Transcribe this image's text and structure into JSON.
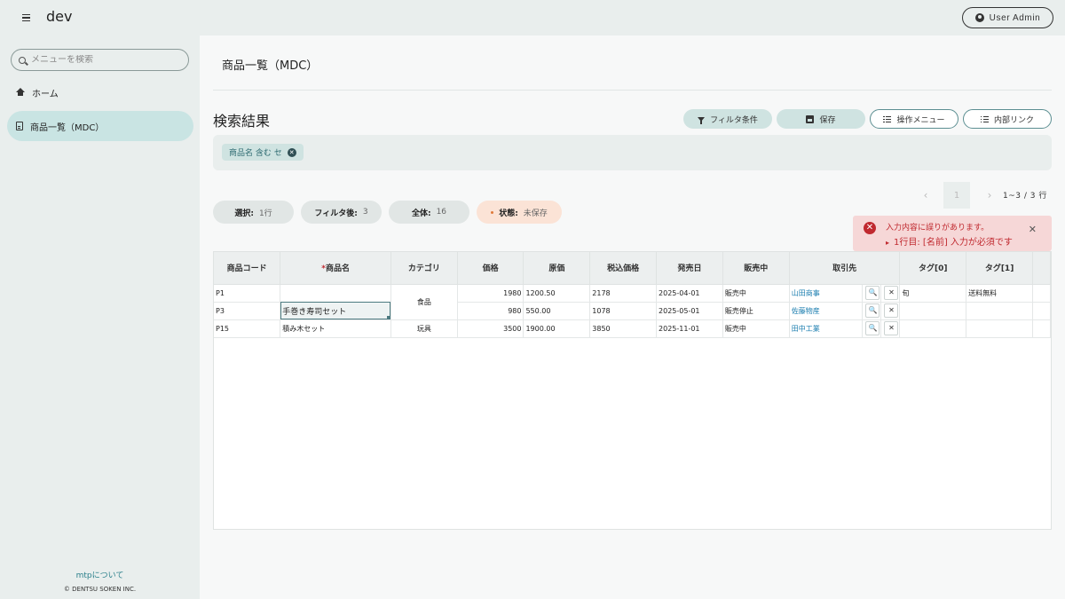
{
  "header": {
    "app_title": "dev",
    "user_label": "User Admin"
  },
  "sidebar": {
    "search_placeholder": "メニューを検索",
    "items": [
      {
        "label": "ホーム",
        "icon": "home-icon"
      },
      {
        "label": "商品一覧（MDC）",
        "icon": "document-icon",
        "active": true
      }
    ],
    "about_link": "mtpについて",
    "copyright": "© DENTSU SOKEN INC."
  },
  "main": {
    "page_title": "商品一覧（MDC）",
    "section_title": "検索結果",
    "toolbar": {
      "filter_label": "フィルタ条件",
      "save_label": "保存",
      "ops_label": "操作メニュー",
      "links_label": "内部リンク"
    },
    "filter_chip": "商品名 含む セ",
    "pager": {
      "prev": "‹",
      "page": "1",
      "next": "›",
      "range": "1~3 / 3 行"
    },
    "stats": {
      "selected_label": "選択:",
      "selected_value": "1行",
      "filtered_label": "フィルタ後:",
      "filtered_value": "3",
      "total_label": "全体:",
      "total_value": "16",
      "state_label": "状態:",
      "state_value": "未保存"
    },
    "error": {
      "title": "入力内容に誤りがあります。",
      "message": "1行目: [名前] 入力が必須です",
      "icon": "error-icon",
      "color": "#c0292f"
    }
  },
  "table": {
    "columns": [
      "商品コード",
      "商品名",
      "カテゴリ",
      "価格",
      "原価",
      "税込価格",
      "発売日",
      "販売中",
      "取引先",
      "タグ[0]",
      "タグ[1]"
    ],
    "required_mark": "*",
    "merged_category": "食品",
    "rows": [
      {
        "code": "P1",
        "name": "",
        "category": "食品",
        "price": "1980",
        "cost": "1200.50",
        "tax": "2178",
        "date": "2025-04-01",
        "status": "販売中",
        "partner": "山田商事",
        "tag0": "旬",
        "tag1": "送料無料"
      },
      {
        "code": "P3",
        "name": "手巻き寿司セット",
        "category": "食品",
        "price": "980",
        "cost": "550.00",
        "tax": "1078",
        "date": "2025-05-01",
        "status": "販売停止",
        "partner": "佐藤物産",
        "tag0": "",
        "tag1": ""
      },
      {
        "code": "P15",
        "name": "積み木セット",
        "category": "玩具",
        "price": "3500",
        "cost": "1900.00",
        "tax": "3850",
        "date": "2025-11-01",
        "status": "販売中",
        "partner": "田中工業",
        "tag0": "",
        "tag1": ""
      }
    ]
  },
  "colors": {
    "accent": "#2a7f8a",
    "active_nav": "#c9e4e3",
    "link": "#1e7fb0",
    "warn": "#e07a3a"
  }
}
